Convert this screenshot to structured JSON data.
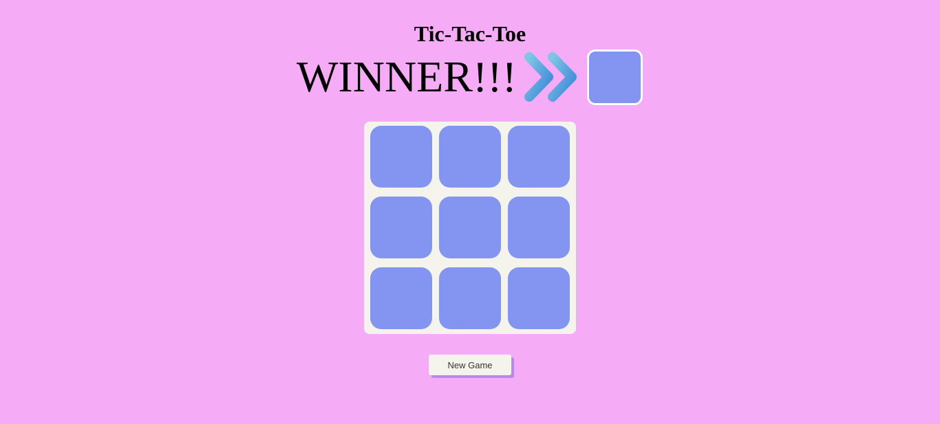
{
  "header": {
    "title": "Tic-Tac-Toe"
  },
  "status": {
    "winner_text": "WINNER!!!",
    "arrow_icon": "double-chevron-right-icon",
    "winner_color": "#8395f0"
  },
  "board": {
    "cells": [
      "",
      "",
      "",
      "",
      "",
      "",
      "",
      "",
      ""
    ],
    "cell_color": "#8395f0",
    "background_color": "#f4f4ec"
  },
  "controls": {
    "new_game_label": "New Game"
  },
  "colors": {
    "page_background": "#f5abf5",
    "button_shadow": "#b988ee"
  }
}
